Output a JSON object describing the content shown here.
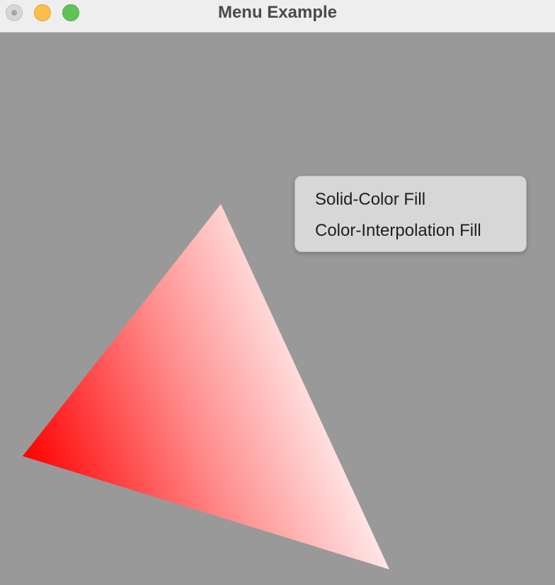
{
  "window": {
    "title": "Menu Example",
    "controls": {
      "close": "close-button",
      "minimize": "minimize-button",
      "zoom": "zoom-button"
    }
  },
  "canvas": {
    "background": "#999999",
    "shape": "triangle",
    "fill_mode": "color-interpolation",
    "vertex_colors": [
      "#ff0000",
      "#ffffff",
      "#ffffff"
    ]
  },
  "context_menu": {
    "items": [
      {
        "label": "Solid-Color Fill"
      },
      {
        "label": "Color-Interpolation Fill"
      }
    ]
  }
}
